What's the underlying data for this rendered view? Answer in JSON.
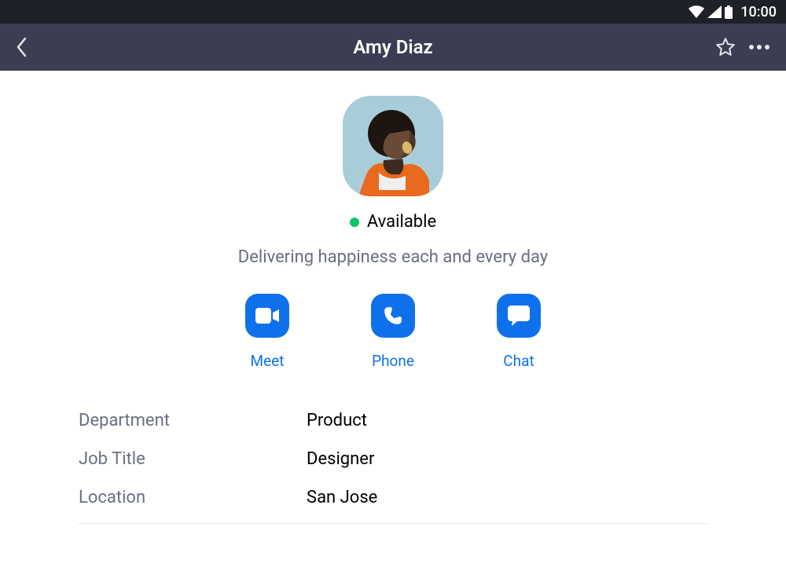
{
  "statusbar": {
    "time": "10:00"
  },
  "header": {
    "title": "Amy Diaz"
  },
  "profile": {
    "status_text": "Available",
    "status_color": "#0ac76b",
    "tagline": "Delivering happiness each and every day"
  },
  "actions": {
    "meet": {
      "label": "Meet"
    },
    "phone": {
      "label": "Phone"
    },
    "chat": {
      "label": "Chat"
    }
  },
  "details": {
    "department": {
      "label": "Department",
      "value": "Product"
    },
    "job_title": {
      "label": "Job Title",
      "value": "Designer"
    },
    "location": {
      "label": "Location",
      "value": "San Jose"
    }
  }
}
